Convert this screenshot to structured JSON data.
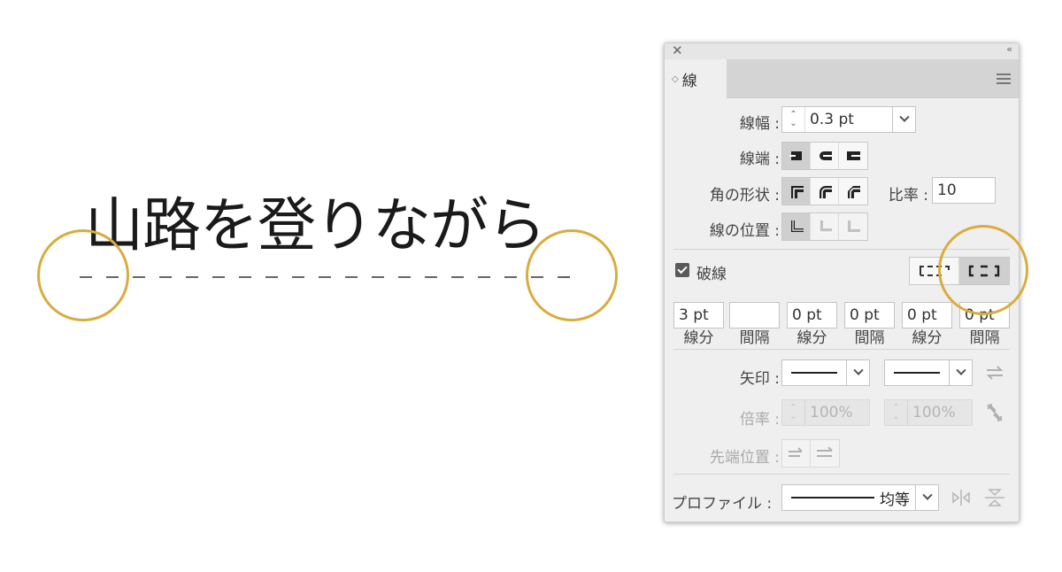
{
  "artwork": {
    "sample_text": "山路を登りながら"
  },
  "panel": {
    "tab_label": "線",
    "stroke_weight": {
      "label": "線幅 :",
      "value": "0.3 pt"
    },
    "cap": {
      "label": "線端 :"
    },
    "corner": {
      "label": "角の形状 :",
      "limit_label": "比率 :",
      "limit_value": "10"
    },
    "align": {
      "label": "線の位置 :"
    },
    "dashed": {
      "label": "破線",
      "checked": true
    },
    "dash_fields": [
      {
        "value": "3 pt",
        "caption": "線分"
      },
      {
        "value": "",
        "caption": "間隔"
      },
      {
        "value": "0 pt",
        "caption": "線分"
      },
      {
        "value": "0 pt",
        "caption": "間隔"
      },
      {
        "value": "0 pt",
        "caption": "線分"
      },
      {
        "value": "0 pt",
        "caption": "間隔"
      }
    ],
    "arrowheads": {
      "label": "矢印 :"
    },
    "scale": {
      "label": "倍率 :",
      "start": "100%",
      "end": "100%"
    },
    "align_arrows": {
      "label": "先端位置 :"
    },
    "profile": {
      "label": "プロファイル :",
      "value": "均等"
    }
  },
  "colors": {
    "highlight": "#d9ac3e",
    "panel_bg": "#efefef",
    "active_button": "#cfcfcf"
  }
}
